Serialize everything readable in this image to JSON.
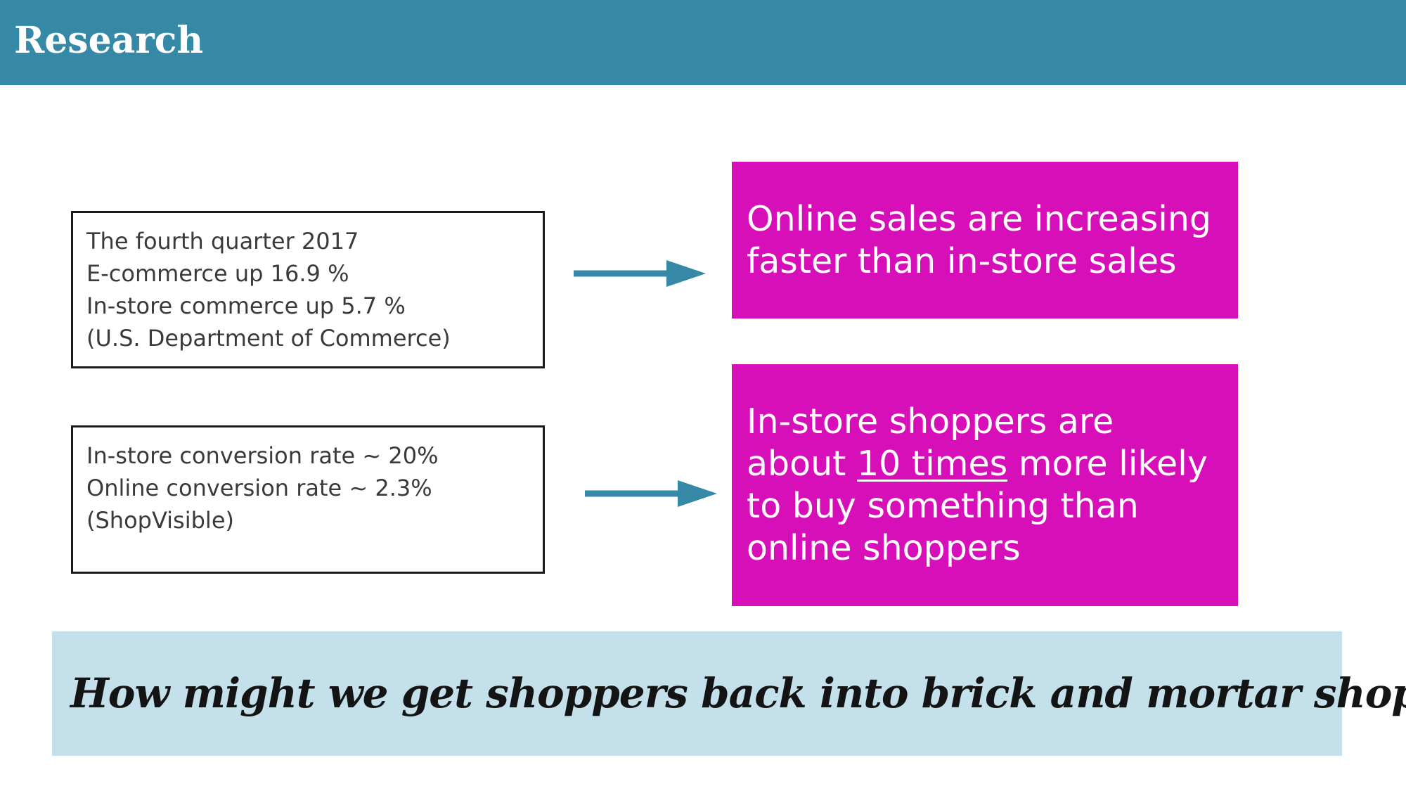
{
  "header": {
    "title": "Research"
  },
  "facts": {
    "box1": {
      "lines": [
        "The fourth quarter 2017",
        "E-commerce up 16.9 %",
        "In-store commerce up 5.7 %",
        "(U.S. Department of Commerce)"
      ]
    },
    "box2": {
      "lines": [
        "In-store conversion rate ~ 20%",
        "Online conversion rate ~ 2.3%",
        "(ShopVisible)"
      ]
    }
  },
  "insights": {
    "insight1": {
      "lines": [
        "Online sales are increasing",
        "faster than in-store sales"
      ]
    },
    "insight2": {
      "line1": "In-store shoppers are",
      "line2_pre": "about ",
      "line2_emphasis": "10 times",
      "line2_post": " more likely",
      "line3": "to buy something than",
      "line4": "online shoppers"
    }
  },
  "question": {
    "text": "How might we get shoppers back into brick and mortar shops?"
  },
  "colors": {
    "header": "#3689a6",
    "arrow": "#3689a6",
    "insight_background": "#d70fb8",
    "question_background": "#c4e1eb"
  }
}
